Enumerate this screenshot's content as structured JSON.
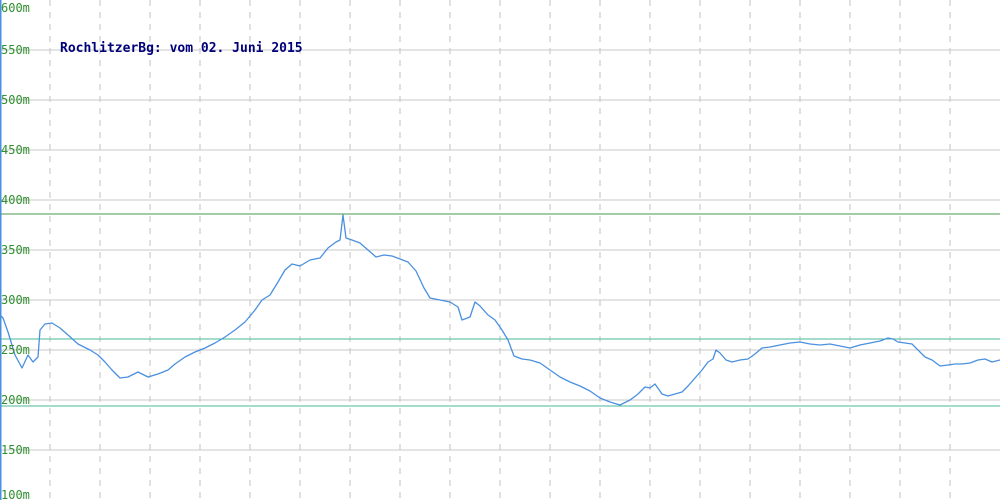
{
  "chart_data": {
    "type": "line",
    "title": "RochlitzerBg: vom 02. Juni 2015",
    "xlabel": "",
    "ylabel": "",
    "ylim": [
      100,
      600
    ],
    "y_ticks": [
      100,
      150,
      200,
      250,
      300,
      350,
      400,
      450,
      500,
      550,
      600
    ],
    "y_tick_labels": [
      "100m",
      "150m",
      "200m",
      "250m",
      "300m",
      "350m",
      "400m",
      "450m",
      "500m",
      "550m",
      "600m"
    ],
    "x_range": [
      0,
      1000
    ],
    "grid": true,
    "legend": "none",
    "colors": {
      "series": "#4a90e0",
      "max_line": "#4a9a4a",
      "avg_line": "#49b89a",
      "min_line": "#49b89a",
      "vertical_grid": "#c0c0c0",
      "horizontal_grid": "#c8c8c8",
      "tick_text": "#2f8f2f",
      "title_text": "#00007a"
    },
    "reference_lines": {
      "max": 386,
      "avg": 261,
      "min": 194
    },
    "series": [
      {
        "values": [
          [
            0,
            285
          ],
          [
            3,
            282
          ],
          [
            8,
            268
          ],
          [
            15,
            245
          ],
          [
            22,
            232
          ],
          [
            28,
            245
          ],
          [
            33,
            238
          ],
          [
            38,
            243
          ],
          [
            40,
            270
          ],
          [
            45,
            276
          ],
          [
            52,
            277
          ],
          [
            60,
            272
          ],
          [
            68,
            265
          ],
          [
            78,
            256
          ],
          [
            90,
            250
          ],
          [
            98,
            245
          ],
          [
            105,
            238
          ],
          [
            112,
            230
          ],
          [
            120,
            222
          ],
          [
            128,
            223
          ],
          [
            138,
            228
          ],
          [
            148,
            223
          ],
          [
            158,
            226
          ],
          [
            168,
            230
          ],
          [
            175,
            236
          ],
          [
            185,
            243
          ],
          [
            195,
            248
          ],
          [
            205,
            252
          ],
          [
            215,
            257
          ],
          [
            225,
            263
          ],
          [
            235,
            270
          ],
          [
            245,
            278
          ],
          [
            255,
            290
          ],
          [
            262,
            300
          ],
          [
            270,
            305
          ],
          [
            278,
            318
          ],
          [
            285,
            330
          ],
          [
            292,
            336
          ],
          [
            300,
            334
          ],
          [
            310,
            340
          ],
          [
            320,
            342
          ],
          [
            328,
            352
          ],
          [
            336,
            358
          ],
          [
            340,
            360
          ],
          [
            343,
            385
          ],
          [
            346,
            362
          ],
          [
            352,
            360
          ],
          [
            360,
            357
          ],
          [
            368,
            350
          ],
          [
            376,
            343
          ],
          [
            384,
            345
          ],
          [
            392,
            344
          ],
          [
            400,
            341
          ],
          [
            408,
            338
          ],
          [
            416,
            329
          ],
          [
            424,
            312
          ],
          [
            430,
            302
          ],
          [
            440,
            300
          ],
          [
            450,
            298
          ],
          [
            458,
            293
          ],
          [
            462,
            280
          ],
          [
            470,
            283
          ],
          [
            475,
            298
          ],
          [
            480,
            294
          ],
          [
            488,
            285
          ],
          [
            495,
            280
          ],
          [
            502,
            270
          ],
          [
            508,
            260
          ],
          [
            514,
            244
          ],
          [
            522,
            241
          ],
          [
            530,
            240
          ],
          [
            540,
            237
          ],
          [
            550,
            230
          ],
          [
            560,
            223
          ],
          [
            570,
            218
          ],
          [
            580,
            214
          ],
          [
            590,
            209
          ],
          [
            600,
            202
          ],
          [
            610,
            198
          ],
          [
            620,
            195
          ],
          [
            630,
            200
          ],
          [
            638,
            206
          ],
          [
            645,
            213
          ],
          [
            650,
            212
          ],
          [
            655,
            216
          ],
          [
            662,
            206
          ],
          [
            668,
            204
          ],
          [
            675,
            206
          ],
          [
            682,
            208
          ],
          [
            688,
            214
          ],
          [
            695,
            222
          ],
          [
            702,
            230
          ],
          [
            708,
            238
          ],
          [
            713,
            241
          ],
          [
            716,
            250
          ],
          [
            720,
            247
          ],
          [
            726,
            240
          ],
          [
            732,
            238
          ],
          [
            740,
            240
          ],
          [
            748,
            241
          ],
          [
            755,
            246
          ],
          [
            762,
            252
          ],
          [
            770,
            253
          ],
          [
            780,
            255
          ],
          [
            790,
            257
          ],
          [
            800,
            258
          ],
          [
            810,
            256
          ],
          [
            820,
            255
          ],
          [
            830,
            256
          ],
          [
            840,
            254
          ],
          [
            850,
            252
          ],
          [
            860,
            255
          ],
          [
            870,
            257
          ],
          [
            880,
            259
          ],
          [
            888,
            262
          ],
          [
            893,
            261
          ],
          [
            898,
            258
          ],
          [
            905,
            257
          ],
          [
            912,
            256
          ],
          [
            918,
            250
          ],
          [
            925,
            243
          ],
          [
            932,
            240
          ],
          [
            940,
            234
          ],
          [
            948,
            235
          ],
          [
            955,
            236
          ],
          [
            962,
            236
          ],
          [
            970,
            237
          ],
          [
            978,
            240
          ],
          [
            985,
            241
          ],
          [
            992,
            238
          ],
          [
            1000,
            240
          ]
        ]
      }
    ]
  }
}
